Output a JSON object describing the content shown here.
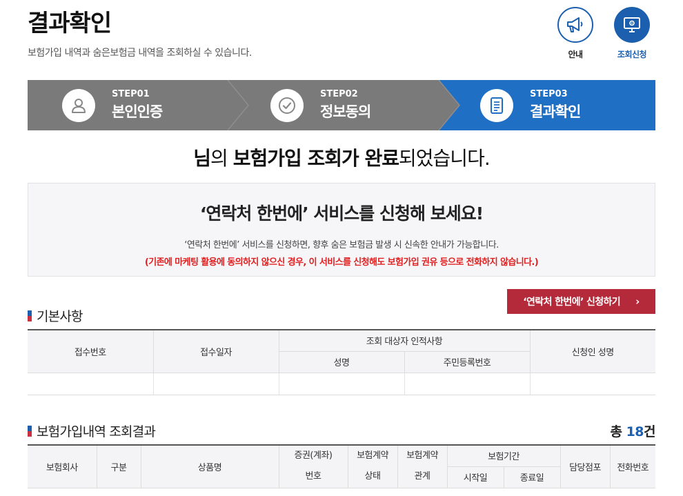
{
  "page": {
    "title": "결과확인",
    "description": "보험가입 내역과 숨은보험금 내역을 조회하실 수 있습니다."
  },
  "quick_links": {
    "info_label": "안내",
    "apply_label": "조회신청"
  },
  "steps": [
    {
      "number": "STEP01",
      "name": "본인인증",
      "icon": "person-icon"
    },
    {
      "number": "STEP02",
      "name": "정보동의",
      "icon": "check-circle-icon"
    },
    {
      "number": "STEP03",
      "name": "결과확인",
      "icon": "document-icon"
    }
  ],
  "completion": {
    "name_suffix": "님",
    "part1": "의 ",
    "bold1": "보험가입 조회가 완료",
    "part2": "되었습니다."
  },
  "promo": {
    "title": "‘연락처 한번에’ 서비스를 신청해 보세요!",
    "description": "‘연락처 한번에’ 서비스를 신청하면, 향후 숨은 보험금 발생 시 신속한 안내가 가능합니다.",
    "warning": "(기존에 마케팅 활용에 동의하지 않으신 경우, 이 서비스를 신청해도 보험가입 권유 등으로 전화하지 않습니다.)",
    "apply_button": "‘연락처 한번에’ 신청하기",
    "apply_chevron": "›"
  },
  "basic_info": {
    "title": "기본사항",
    "headers": {
      "receipt_no": "접수번호",
      "receipt_date": "접수일자",
      "subject_group": "조회 대상자 인적사항",
      "name": "성명",
      "rrn": "주민등록번호",
      "applicant_name": "신청인 성명"
    }
  },
  "results": {
    "title": "보험가입내역 조회결과",
    "total_prefix": "총 ",
    "total_count": "18",
    "total_suffix": "건",
    "headers": {
      "company": "보험회사",
      "type": "구분",
      "product": "상품명",
      "policy_line1": "증권(계좌)",
      "policy_line2": "번호",
      "status_line1": "보험계약",
      "status_line2": "상태",
      "relation_line1": "보험계약",
      "relation_line2": "관계",
      "period": "보험기간",
      "start": "시작일",
      "end": "종료일",
      "branch": "담당점포",
      "phone": "전화번호"
    }
  },
  "colors": {
    "primary": "#1b5fae",
    "step_inactive": "#7a7a7a",
    "step_active": "#1f6fc5",
    "apply_button": "#b52a3a",
    "warning": "#e02020"
  }
}
